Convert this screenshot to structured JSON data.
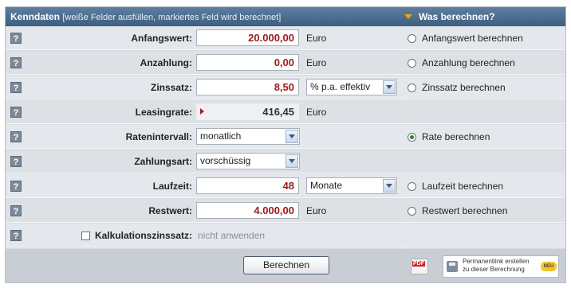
{
  "header": {
    "title": "Kenndaten",
    "subtitle": "[weiße Felder ausfüllen, markiertes Feld wird berechnet]",
    "right_title": "Was berechnen?"
  },
  "help_glyph": "?",
  "rows": {
    "anfangswert": {
      "label": "Anfangswert:",
      "value": "20.000,00",
      "unit": "Euro",
      "radio": "Anfangswert berechnen"
    },
    "anzahlung": {
      "label": "Anzahlung:",
      "value": "0,00",
      "unit": "Euro",
      "radio": "Anzahlung berechnen"
    },
    "zinssatz": {
      "label": "Zinssatz:",
      "value": "8,50",
      "unit_select": "% p.a. effektiv",
      "radio": "Zinssatz berechnen"
    },
    "leasingrate": {
      "label": "Leasingrate:",
      "value": "416,45",
      "unit": "Euro"
    },
    "ratenintervall": {
      "label": "Ratenintervall:",
      "select": "monatlich",
      "radio": "Rate berechnen"
    },
    "zahlungsart": {
      "label": "Zahlungsart:",
      "select": "vorschüssig"
    },
    "laufzeit": {
      "label": "Laufzeit:",
      "value": "48",
      "unit_select": "Monate",
      "radio": "Laufzeit berechnen"
    },
    "restwert": {
      "label": "Restwert:",
      "value": "4.000,00",
      "unit": "Euro",
      "radio": "Restwert berechnen"
    },
    "kalkulationszins": {
      "label": "Kalkulationszinssatz:",
      "value": "nicht anwenden"
    }
  },
  "selected_radio": "Rate berechnen",
  "footer": {
    "button": "Berechnen",
    "pdf_label": "PDF",
    "permalink_line1": "Permanentlink erstellen",
    "permalink_line2": "zu dieser Berechnung",
    "badge": "NEU"
  }
}
